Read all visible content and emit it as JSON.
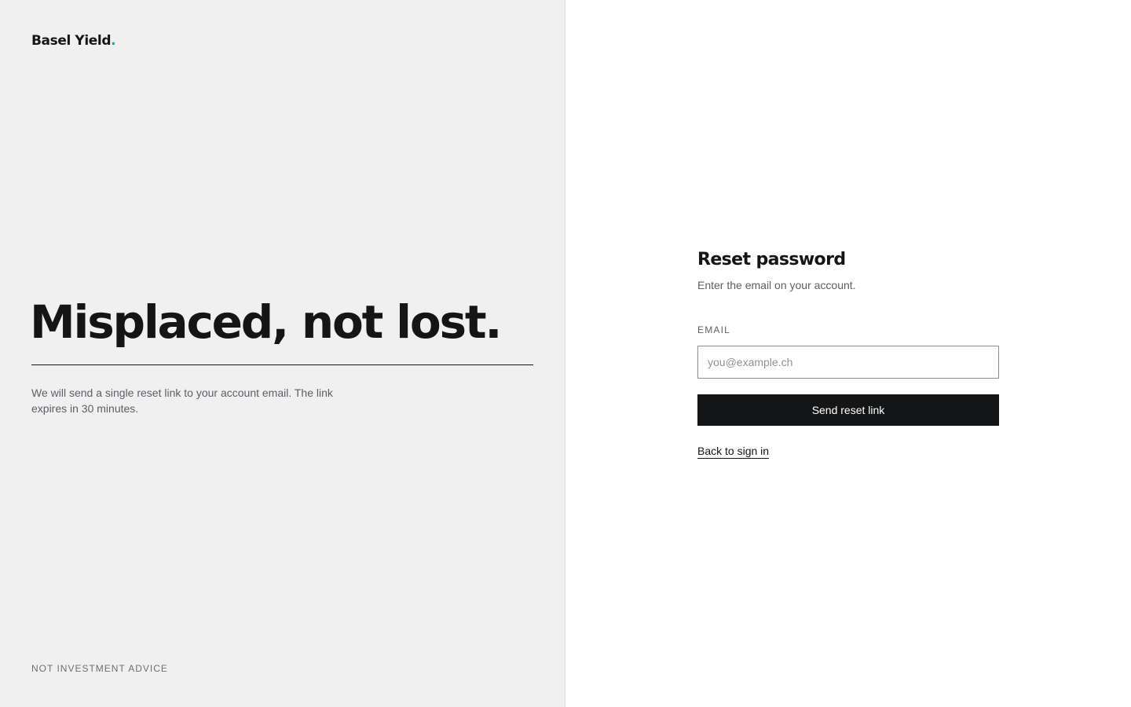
{
  "brand": {
    "name": "Basel Yield",
    "dot": ".",
    "dot_color": "#1aa6a6"
  },
  "hero": {
    "headline": "Misplaced, not lost.",
    "blurb": "We will send a single reset link to your account email. The link expires in 30 minutes."
  },
  "footer": {
    "disclaimer": "NOT INVESTMENT ADVICE"
  },
  "form": {
    "title": "Reset password",
    "subtitle": "Enter the email on your account.",
    "email_label": "EMAIL",
    "email_placeholder": "you@example.ch",
    "email_value": "",
    "submit_label": "Send reset link",
    "back_link_label": "Back to sign in"
  },
  "colors": {
    "left_panel_bg": "#f0f0f0",
    "button_bg": "#141517",
    "text_primary": "#141517",
    "text_muted": "#5b5f66"
  }
}
